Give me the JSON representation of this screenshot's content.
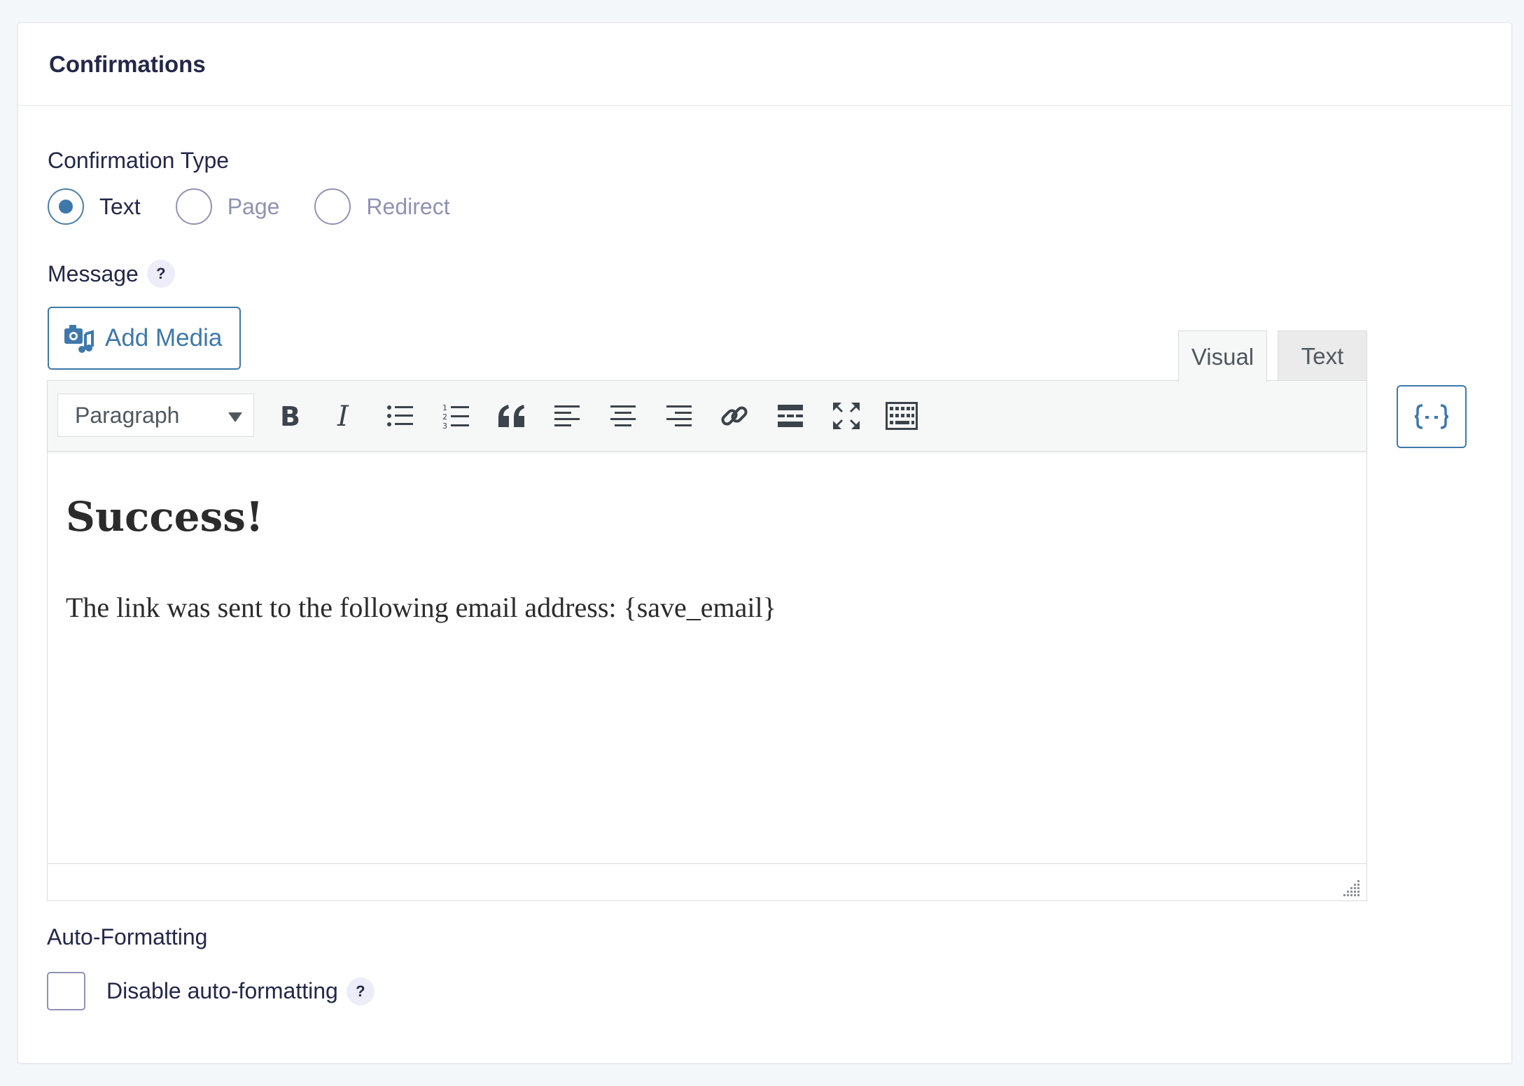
{
  "panel": {
    "title": "Confirmations"
  },
  "confirmation_type": {
    "label": "Confirmation Type",
    "options": [
      {
        "label": "Text",
        "checked": true
      },
      {
        "label": "Page",
        "checked": false
      },
      {
        "label": "Redirect",
        "checked": false
      }
    ]
  },
  "message": {
    "label": "Message",
    "help": "?",
    "add_media_label": "Add Media",
    "tabs": {
      "visual": "Visual",
      "text": "Text"
    },
    "format_select": "Paragraph",
    "toolbar_icons": [
      "bold-icon",
      "italic-icon",
      "bulleted-list-icon",
      "numbered-list-icon",
      "blockquote-icon",
      "align-left-icon",
      "align-center-icon",
      "align-right-icon",
      "link-icon",
      "read-more-icon",
      "fullscreen-icon",
      "toolbar-toggle-icon"
    ],
    "content": {
      "heading": "Success!",
      "paragraph": "The link was sent to the following email address: {save_email}"
    },
    "merge_tags_icon": "merge-tags-icon"
  },
  "auto_formatting": {
    "label": "Auto-Formatting",
    "checkbox_label": "Disable auto-formatting",
    "checked": false,
    "help": "?"
  },
  "colors": {
    "accent": "#3e78aa",
    "heading": "#242748"
  }
}
